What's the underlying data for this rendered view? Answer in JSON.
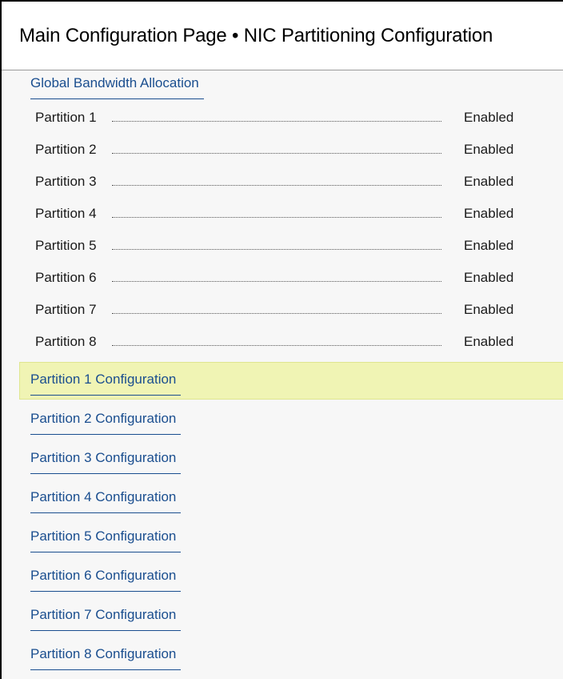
{
  "header": {
    "title": "Main Configuration Page • NIC Partitioning Configuration"
  },
  "global_bandwidth": {
    "label": "Global Bandwidth Allocation"
  },
  "partitions": [
    {
      "label": "Partition 1",
      "value": "Enabled"
    },
    {
      "label": "Partition 2",
      "value": "Enabled"
    },
    {
      "label": "Partition 3",
      "value": "Enabled"
    },
    {
      "label": "Partition 4",
      "value": "Enabled"
    },
    {
      "label": "Partition 5",
      "value": "Enabled"
    },
    {
      "label": "Partition 6",
      "value": "Enabled"
    },
    {
      "label": "Partition 7",
      "value": "Enabled"
    },
    {
      "label": "Partition 8",
      "value": "Enabled"
    }
  ],
  "config_links": [
    {
      "label": "Partition 1 Configuration",
      "selected": true
    },
    {
      "label": "Partition 2 Configuration",
      "selected": false
    },
    {
      "label": "Partition 3 Configuration",
      "selected": false
    },
    {
      "label": "Partition 4 Configuration",
      "selected": false
    },
    {
      "label": "Partition 5 Configuration",
      "selected": false
    },
    {
      "label": "Partition 6 Configuration",
      "selected": false
    },
    {
      "label": "Partition 7 Configuration",
      "selected": false
    },
    {
      "label": "Partition 8 Configuration",
      "selected": false
    }
  ],
  "colors": {
    "link": "#1a4e8f",
    "highlight": "#f0f4b4",
    "background": "#f7f7f7"
  }
}
